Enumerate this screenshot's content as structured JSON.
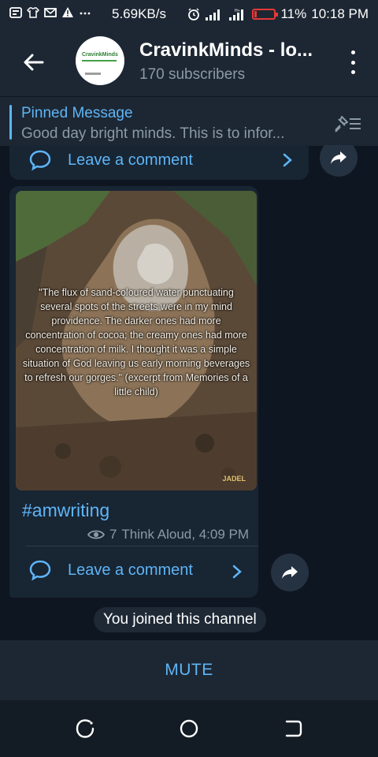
{
  "status_bar": {
    "speed": "5.69KB/s",
    "battery": "11%",
    "battery_level": 0.11,
    "time": "10:18 PM",
    "icons": [
      "notification-icon",
      "shirt-icon",
      "mail-icon",
      "warning-icon",
      "more-icon",
      "alarm-icon",
      "signal-icon",
      "signal-hplus-icon",
      "battery-icon"
    ]
  },
  "header": {
    "title": "CravinkMinds - lo...",
    "subtitle": "170 subscribers",
    "avatar_logo_text": "CravinkMinds"
  },
  "pinned": {
    "label": "Pinned Message",
    "text": "Good day bright minds. This is to infor..."
  },
  "previous_post": {
    "comment_label": "Leave a comment"
  },
  "post": {
    "quote": "\"The flux of sand-coloured water punctuating several spots of the streets were in my mind providence. The darker ones had more concentration of cocoa; the creamy ones had more concentration of milk. I thought it was a simple situation of God leaving us early morning beverages to refresh our gorges.\"  (excerpt from Memories of a little child)",
    "watermark": "JADEL",
    "hashtag": "#amwriting",
    "views": "7",
    "author_time": "Think Aloud, 4:09 PM",
    "comment_label": "Leave a comment"
  },
  "service_message": "You joined this channel",
  "bottom": {
    "mute_label": "MUTE"
  },
  "colors": {
    "accent": "#5eb5f7",
    "background": "#0e1621",
    "bubble": "#182533",
    "header": "#1d2733",
    "battery": "#e53935"
  }
}
